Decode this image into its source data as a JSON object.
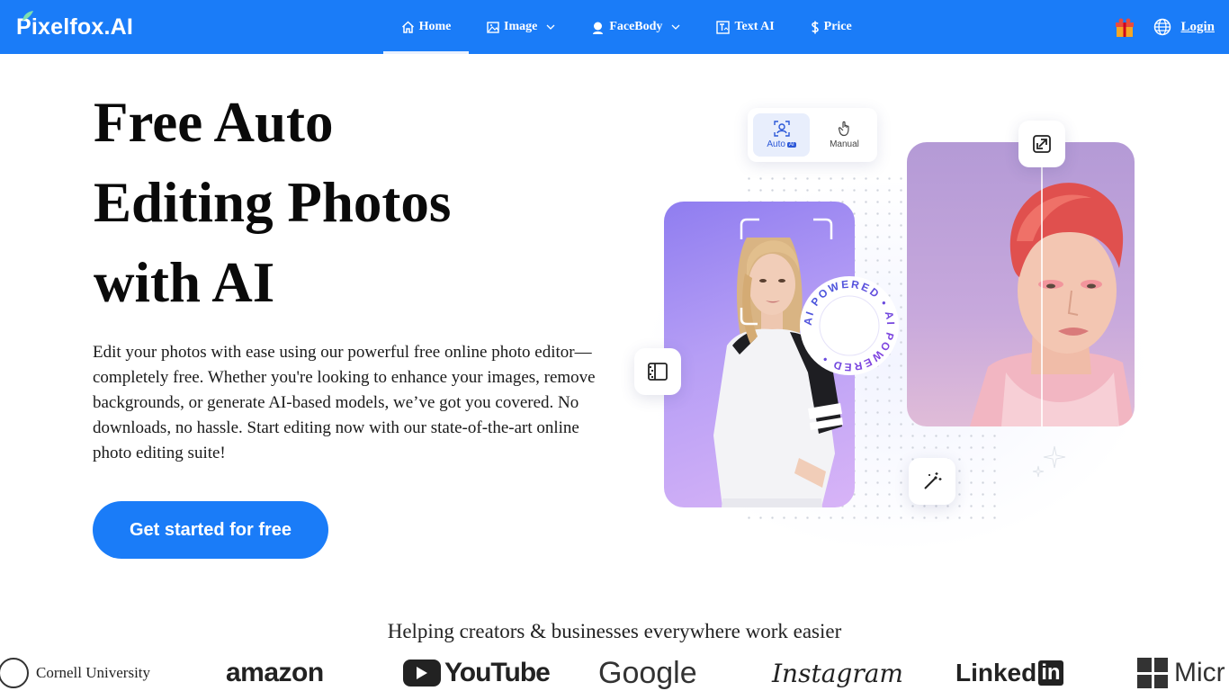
{
  "nav": {
    "logo": "Pixelfox.AI",
    "items": [
      {
        "label": "Home",
        "icon": "home-icon",
        "active": true
      },
      {
        "label": "Image",
        "icon": "image-icon",
        "dropdown": true
      },
      {
        "label": "FaceBody",
        "icon": "face-icon",
        "dropdown": true
      },
      {
        "label": "Text AI",
        "icon": "text-ai-icon"
      },
      {
        "label": "Price",
        "icon": "dollar-icon"
      }
    ],
    "login": "Login"
  },
  "hero": {
    "title": "Free Auto Editing Photos with AI",
    "title_lines": [
      "Free Auto",
      "Editing Photos",
      "with AI"
    ],
    "description": "Edit your photos with ease using our powerful free online photo editor—completely free. Whether you're looking to enhance your images, remove backgrounds, or generate AI-based models, we’ve got you covered. No downloads, no hassle. Start editing now with our state-of-the-art online photo editing suite!",
    "cta": "Get started for free"
  },
  "illustration": {
    "mode_auto": "Auto",
    "mode_auto_chip": "AI",
    "mode_manual": "Manual",
    "badge_text": "AI POWERED • AI POWERED •"
  },
  "trust": {
    "heading": "Helping creators & businesses everywhere work easier",
    "logos": [
      "Cornell University",
      "amazon",
      "YouTube",
      "Google",
      "Instagram",
      "Linked",
      "in",
      "Micr"
    ]
  },
  "colors": {
    "brand": "#1a7cf8",
    "text": "#111111"
  }
}
